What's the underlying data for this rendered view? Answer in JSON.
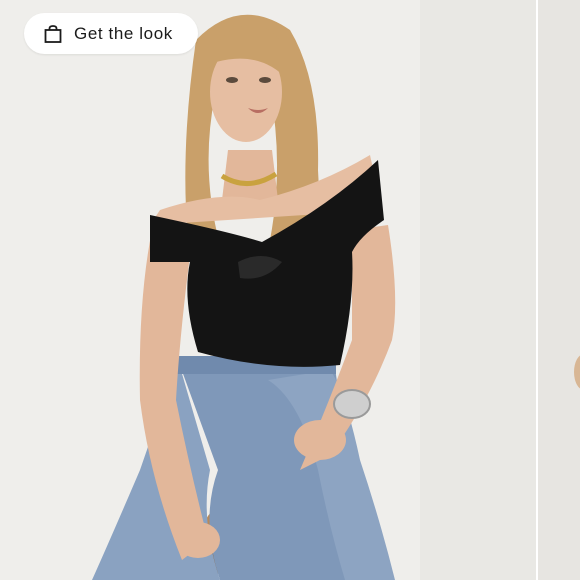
{
  "overlay": {
    "button_label": "Get the look",
    "icon": "shopping-bag-icon"
  },
  "colors": {
    "background": "#efeeeb",
    "top": "#141414",
    "denim": "#7f98b9",
    "hair": "#c9a06a",
    "skin": "#e2b79a"
  }
}
